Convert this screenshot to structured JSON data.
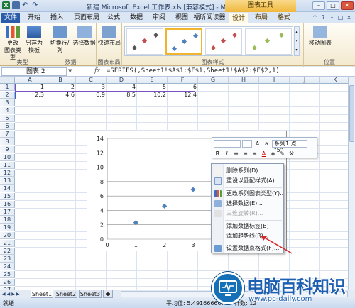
{
  "window": {
    "title": "新建 Microsoft Excel 工作表.xls [兼容模式] - Microsoft Excel",
    "context_tool": "图表工具"
  },
  "tabs": [
    {
      "label": "文件"
    },
    {
      "label": "开始"
    },
    {
      "label": "插入"
    },
    {
      "label": "页面布局"
    },
    {
      "label": "公式"
    },
    {
      "label": "数据"
    },
    {
      "label": "审阅"
    },
    {
      "label": "视图"
    },
    {
      "label": "福昕阅读器"
    },
    {
      "label": "设计"
    },
    {
      "label": "布局"
    },
    {
      "label": "格式"
    }
  ],
  "ribbon": {
    "change_type": "更改\n图表类型",
    "save_template": "另存为\n模板",
    "switch_rowcol": "切换行/列",
    "select_data": "选择数据",
    "quick_layout": "快速布局",
    "move_chart": "移动图表",
    "groups": {
      "type": "类型",
      "data": "数据",
      "layouts": "图表布局",
      "styles": "图表样式",
      "location": "位置"
    }
  },
  "formula_bar": {
    "name_box": "图表 2",
    "fx": "fx",
    "formula": "=SERIES(,Sheet1!$A$1:$F$1,Sheet1!$A$2:$F$2,1)"
  },
  "grid": {
    "columns": [
      "A",
      "B",
      "C",
      "D",
      "E",
      "F",
      "G",
      "H",
      "I",
      "J",
      "K"
    ],
    "rows": [
      "1",
      "2",
      "3",
      "4",
      "5",
      "6",
      "7",
      "8",
      "9",
      "10",
      "11",
      "12",
      "13",
      "14",
      "15",
      "16",
      "17",
      "18",
      "19",
      "20",
      "21",
      "22",
      "23",
      "24",
      "25",
      "26",
      "27",
      "28"
    ],
    "row1": [
      "1",
      "2",
      "3",
      "4",
      "5",
      "6"
    ],
    "row2": [
      "2.3",
      "4.6",
      "6.9",
      "8.5",
      "10.2",
      "12.4"
    ]
  },
  "chart_data": {
    "type": "scatter",
    "x": [
      1,
      2,
      3,
      4,
      5,
      6
    ],
    "y": [
      2.3,
      4.6,
      6.9,
      8.5,
      10.2,
      12.4
    ],
    "yticks": [
      "0",
      "2",
      "4",
      "6",
      "8",
      "10",
      "12",
      "14"
    ],
    "xticks": [
      "0",
      "1",
      "2",
      "3",
      "4",
      "5"
    ],
    "xlim": [
      0,
      6
    ],
    "ylim": [
      0,
      14
    ],
    "grid": true,
    "color": "#4f81bd"
  },
  "mini_toolbar": {
    "series_selector": "系列1 点 \"5\"",
    "buttons": [
      "B",
      "I",
      "≡",
      "≡",
      "≡",
      "A",
      "▾"
    ]
  },
  "context_menu": [
    {
      "label": "删除系列(D)",
      "disabled": false
    },
    {
      "label": "重设以匹配样式(A)",
      "disabled": false
    },
    {
      "label": "更改系列图表类型(Y)...",
      "disabled": false
    },
    {
      "label": "选择数据(E)...",
      "disabled": false
    },
    {
      "label": "三维旋转(R)...",
      "disabled": true
    },
    {
      "label": "添加数据标签(B)",
      "disabled": false
    },
    {
      "label": "添加趋势线(R)...",
      "disabled": false
    },
    {
      "label": "设置数据点格式(F)...",
      "disabled": false
    }
  ],
  "sheets": [
    "Sheet1",
    "Sheet2",
    "Sheet3"
  ],
  "status": {
    "mode": "就绪",
    "average": "平均值: 5.491666667",
    "count": "计数: 12"
  },
  "watermark": {
    "big": "电脑百科知识",
    "small": "www.pc-daily.com"
  }
}
